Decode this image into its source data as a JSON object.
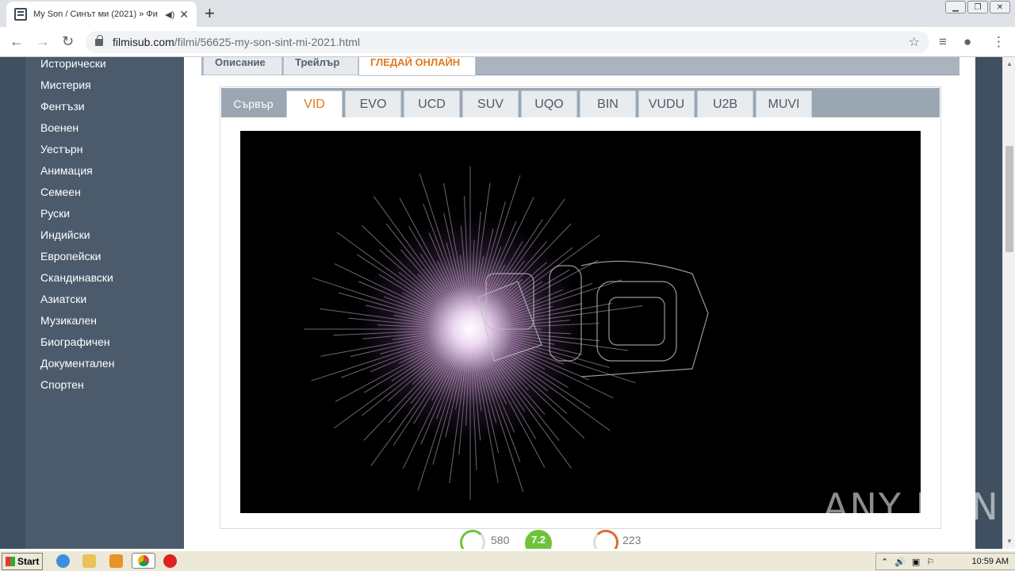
{
  "browser": {
    "tab_title": "My Son / Синът ми (2021) » Фи",
    "url_host": "filmisub.com",
    "url_path": "/filmi/56625-my-son-sint-mi-2021.html"
  },
  "sidebar": {
    "items": [
      "Исторически",
      "Мистерия",
      "Фентъзи",
      "Военен",
      "Уестърн",
      "Анимация",
      "Семеен",
      "Руски",
      "Индийски",
      "Европейски",
      "Скандинавски",
      "Азиатски",
      "Музикален",
      "Биографичен",
      "Документален",
      "Спортен"
    ]
  },
  "content_tabs": [
    "Описание",
    "Трейлър",
    "ГЛЕДАЙ ОНЛАЙН"
  ],
  "server": {
    "label": "Сървър",
    "tabs": [
      "VID",
      "EVO",
      "UCD",
      "SUV",
      "UQO",
      "BIN",
      "VUDU",
      "U2B",
      "MUVI"
    ],
    "active": "VID"
  },
  "rating": {
    "likes": "580",
    "score": "7.2",
    "dislikes": "223"
  },
  "watermark": "ANY RUN",
  "taskbar": {
    "start_label": "Start",
    "clock": "10:59 AM"
  },
  "colors": {
    "accent": "#e07a20",
    "sidebar_bg": "#4b5b6c",
    "score_bg": "#6fc33a"
  }
}
